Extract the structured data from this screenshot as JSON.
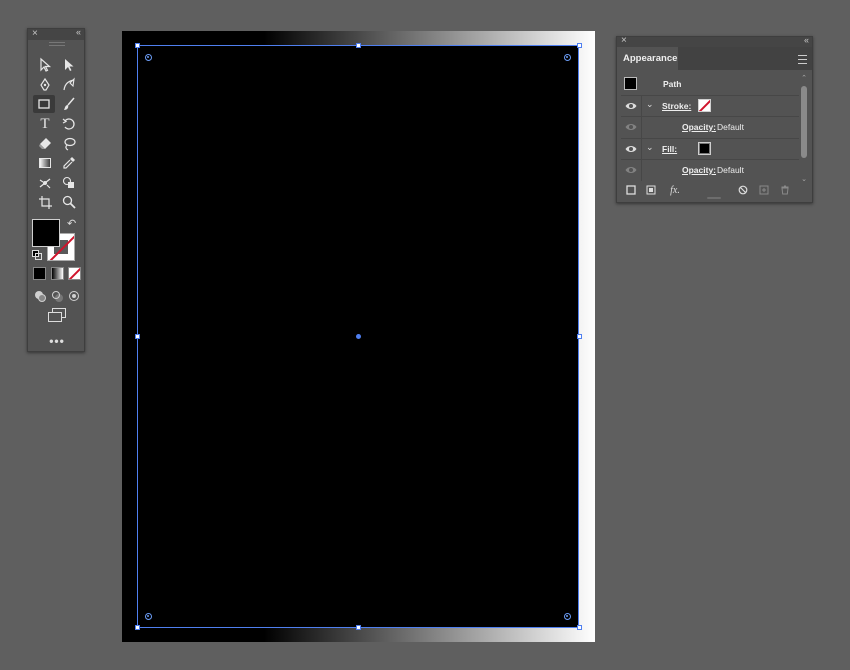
{
  "tools_panel": {
    "close_glyph": "×",
    "collapse_glyph": "‹‹",
    "tools": [
      {
        "name": "selection-tool-icon"
      },
      {
        "name": "direct-selection-tool-icon"
      },
      {
        "name": "pen-tool-icon"
      },
      {
        "name": "curvature-tool-icon"
      },
      {
        "name": "rectangle-tool-icon",
        "active": true
      },
      {
        "name": "paintbrush-tool-icon"
      },
      {
        "name": "type-tool-icon",
        "glyph": "T"
      },
      {
        "name": "rotate-tool-icon"
      },
      {
        "name": "eraser-tool-icon"
      },
      {
        "name": "lasso-tool-icon"
      },
      {
        "name": "gradient-tool-icon"
      },
      {
        "name": "eyedropper-tool-icon"
      },
      {
        "name": "puppet-warp-tool-icon"
      },
      {
        "name": "shape-builder-tool-icon"
      },
      {
        "name": "artboard-tool-icon"
      },
      {
        "name": "zoom-tool-icon"
      }
    ],
    "fill_color": "#000000",
    "stroke_color": "none",
    "swap_glyph": "↶",
    "more_glyph": "•••"
  },
  "document": {
    "background_gradient": [
      "#000000",
      "#ffffff"
    ],
    "rect_fill": "#000000",
    "selection_color": "#4f7ff0"
  },
  "appearance_panel": {
    "close_glyph": "×",
    "collapse_glyph": "‹‹",
    "tab_label": "Appearance",
    "object_label": "Path",
    "rows": [
      {
        "type": "stroke",
        "label": "Stroke:",
        "swatch": "none"
      },
      {
        "type": "opacity",
        "label": "Opacity:",
        "value": "Default"
      },
      {
        "type": "fill",
        "label": "Fill:",
        "swatch": "#000000"
      },
      {
        "type": "opacity",
        "label": "Opacity:",
        "value": "Default"
      }
    ],
    "footer_fx_label": "fx."
  }
}
